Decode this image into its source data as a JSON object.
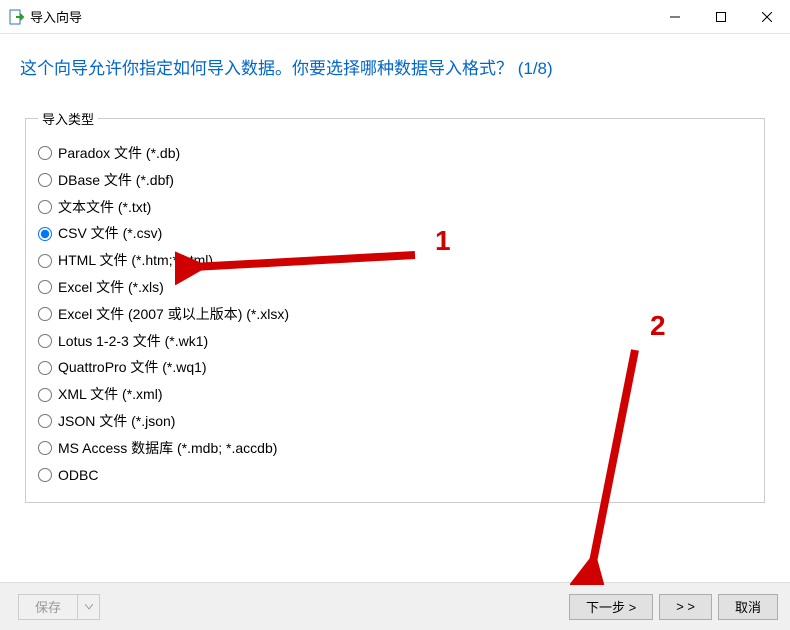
{
  "window": {
    "title": "导入向导"
  },
  "header": {
    "text": "这个向导允许你指定如何导入数据。你要选择哪种数据导入格式？ (1/8)"
  },
  "fieldset": {
    "legend": "导入类型"
  },
  "options": [
    {
      "label": "Paradox 文件 (*.db)",
      "checked": false
    },
    {
      "label": "DBase 文件 (*.dbf)",
      "checked": false
    },
    {
      "label": "文本文件 (*.txt)",
      "checked": false
    },
    {
      "label": "CSV 文件 (*.csv)",
      "checked": true
    },
    {
      "label": "HTML 文件 (*.htm;*.html)",
      "checked": false
    },
    {
      "label": "Excel 文件 (*.xls)",
      "checked": false
    },
    {
      "label": "Excel 文件 (2007 或以上版本) (*.xlsx)",
      "checked": false
    },
    {
      "label": "Lotus 1-2-3 文件 (*.wk1)",
      "checked": false
    },
    {
      "label": "QuattroPro 文件 (*.wq1)",
      "checked": false
    },
    {
      "label": "XML 文件 (*.xml)",
      "checked": false
    },
    {
      "label": "JSON 文件 (*.json)",
      "checked": false
    },
    {
      "label": "MS Access 数据库 (*.mdb; *.accdb)",
      "checked": false
    },
    {
      "label": "ODBC",
      "checked": false
    }
  ],
  "buttons": {
    "save": "保存",
    "next": "下一步 >",
    "skip": "> >",
    "cancel": "取消"
  },
  "annotations": {
    "label1": "1",
    "label2": "2"
  }
}
